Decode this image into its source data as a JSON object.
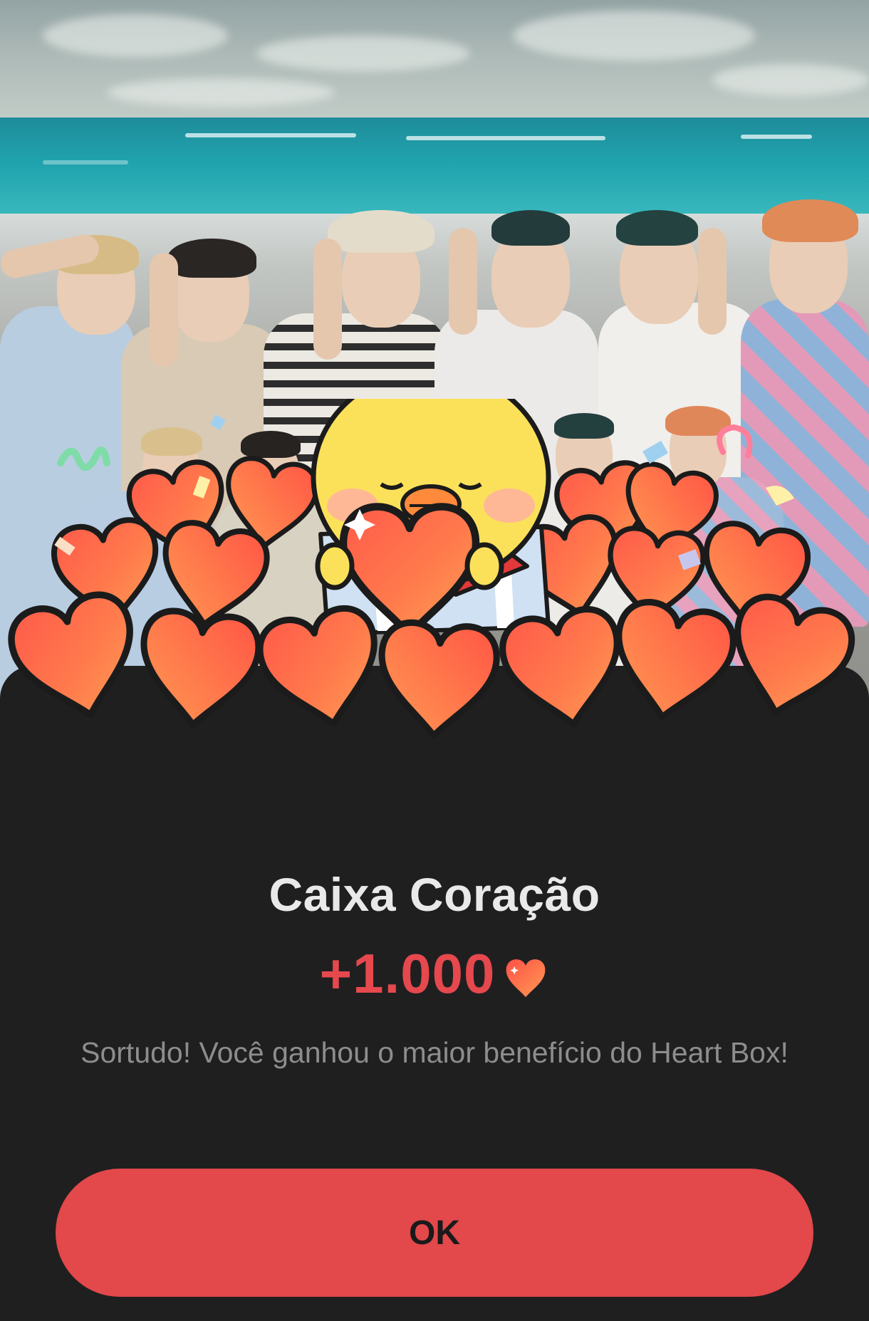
{
  "dialog": {
    "title": "Caixa Coração",
    "reward_amount": "+1.000",
    "message": "Sortudo! Você ganhou o maior benefício do Heart Box!",
    "ok_label": "OK"
  },
  "icons": {
    "reward_icon": "heart-icon",
    "illustration": "chick-holding-heart-in-gift-box"
  },
  "colors": {
    "accent": "#e3484a",
    "reward_text": "#e5484d",
    "sheet_background": "#1f1f20",
    "title_text": "#e9e9e9",
    "message_text": "#8d8d8d"
  }
}
